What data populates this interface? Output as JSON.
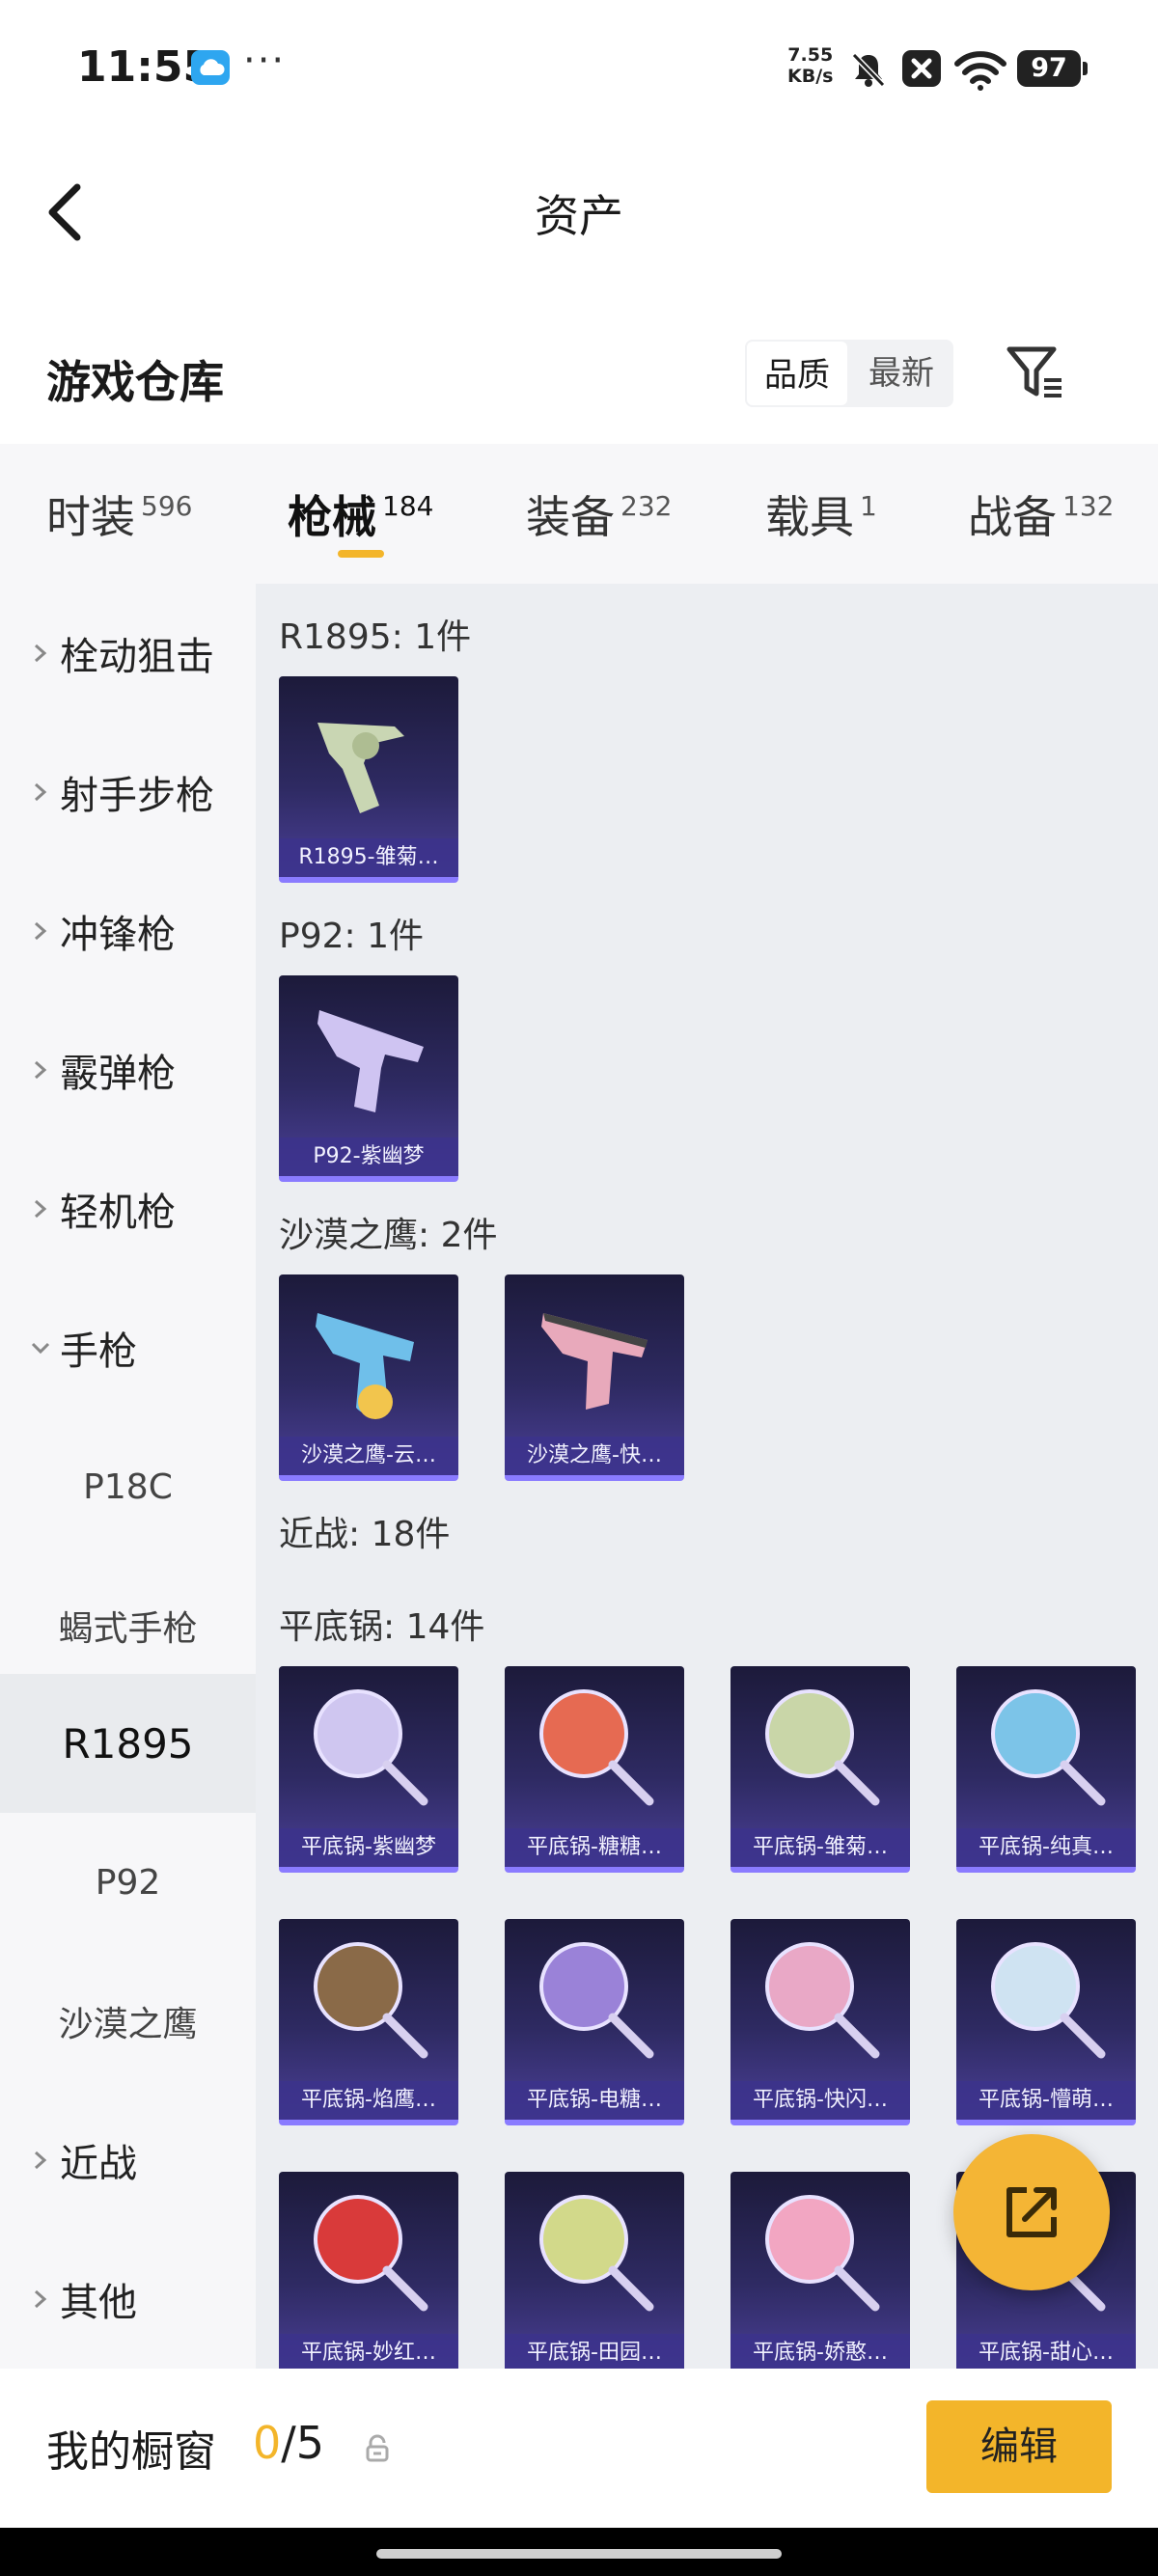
{
  "status_bar": {
    "time": "11:55",
    "more": "···",
    "net_speed_value": "7.55",
    "net_speed_unit": "KB/s",
    "battery": "97",
    "icons": [
      "cloud-icon",
      "mute-icon",
      "close-box-icon",
      "wifi-icon",
      "battery-icon"
    ]
  },
  "header": {
    "title": "资产"
  },
  "section": {
    "title": "游戏仓库",
    "sort_options": [
      "品质",
      "最新"
    ],
    "active_sort": "品质"
  },
  "tabs": [
    {
      "label": "时装",
      "count": "596"
    },
    {
      "label": "枪械",
      "count": "184"
    },
    {
      "label": "装备",
      "count": "232"
    },
    {
      "label": "载具",
      "count": "1"
    },
    {
      "label": "战备",
      "count": "132"
    }
  ],
  "active_tab": "枪械",
  "sidebar": {
    "items": [
      {
        "label": "栓动狙击",
        "kind": "collapsed"
      },
      {
        "label": "射手步枪",
        "kind": "collapsed"
      },
      {
        "label": "冲锋枪",
        "kind": "collapsed"
      },
      {
        "label": "霰弹枪",
        "kind": "collapsed"
      },
      {
        "label": "轻机枪",
        "kind": "collapsed"
      },
      {
        "label": "手枪",
        "kind": "expanded"
      },
      {
        "label": "P18C",
        "kind": "sub"
      },
      {
        "label": "蝎式手枪",
        "kind": "sub"
      },
      {
        "label": "R1895",
        "kind": "sub-selected"
      },
      {
        "label": "P92",
        "kind": "sub"
      },
      {
        "label": "沙漠之鹰",
        "kind": "sub"
      },
      {
        "label": "近战",
        "kind": "collapsed"
      },
      {
        "label": "其他",
        "kind": "collapsed"
      }
    ]
  },
  "groups": [
    {
      "label": "R1895: 1件",
      "items": [
        "R1895-雏菊…"
      ]
    },
    {
      "label": "P92: 1件",
      "items": [
        "P92-紫幽梦"
      ]
    },
    {
      "label": "沙漠之鹰: 2件",
      "items": [
        "沙漠之鹰-云…",
        "沙漠之鹰-快…"
      ]
    },
    {
      "label": "近战: 18件",
      "items": []
    },
    {
      "label": "平底锅: 14件",
      "items": [
        "平底锅-紫幽梦",
        "平底锅-糖糖…",
        "平底锅-雏菊…",
        "平底锅-纯真…",
        "平底锅-焰鹰…",
        "平底锅-电糖…",
        "平底锅-快闪…",
        "平底锅-懵萌…",
        "平底锅-妙红…",
        "平底锅-田园…",
        "平底锅-娇憨…",
        "平底锅-甜心…"
      ]
    }
  ],
  "bottom_bar": {
    "label": "我的橱窗",
    "current": "0",
    "separator": "/",
    "max": "5",
    "edit_label": "编辑"
  },
  "colors": {
    "accent": "#f3b52a",
    "card_bg": "#2e2a62",
    "card_caption": "#3c328c"
  }
}
